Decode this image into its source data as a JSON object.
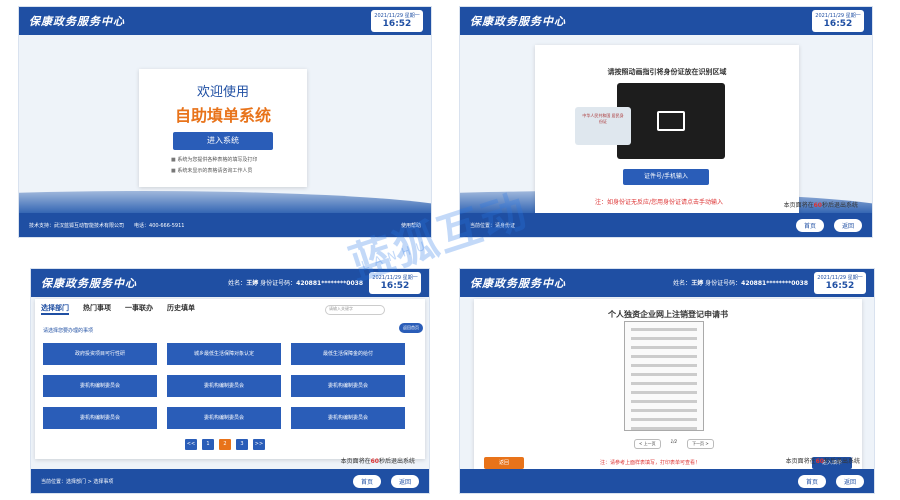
{
  "app_title": "保康政务服务中心",
  "clock": {
    "date": "2021/11/29 星期一",
    "time": "16:52"
  },
  "watermark": {
    "main": "蓝狐互动",
    "sub": "LANHU"
  },
  "panel1": {
    "welcome_line1": "欢迎使用",
    "welcome_line2": "自助填单系统",
    "enter_button": "进入系统",
    "notes": [
      "系统为您提供各种表格的填写及打印",
      "系统未显示的表格请咨询工作人员"
    ],
    "foot_left": "技术支持：武汉蓝狐互动智能技术有限公司",
    "foot_phone": "电话：400-666-5911",
    "foot_help": "使用帮助"
  },
  "panel2": {
    "instruction": "请按照动画指引将身份证放在识别区域",
    "card_text": "中华人民共和国 居民身份证",
    "input_button": "证件号/手机输入",
    "warn": "注：如身份证无反应/您用身份证请点击手动输入",
    "location": "当前位置：请身份证",
    "timer_prefix": "本页面将在",
    "timer_value": "60",
    "timer_suffix": "秒后退出系统",
    "home_button": "首页",
    "back_button": "返回"
  },
  "panel3": {
    "user_name_label": "姓名：",
    "user_name": "王婷",
    "id_label": "身份证号码：",
    "id_value": "420881********0038",
    "tabs": [
      "选择部门",
      "热门事项",
      "一事联办",
      "历史填单"
    ],
    "search_placeholder": "请输入关键字",
    "back_top": "返回首页",
    "hint": "请选择您要办理的事项",
    "items": [
      "政府投资项目可行性研",
      "城乡最低生活保障对象认定",
      "最低生活保障金的给付",
      "委机构编制委员会",
      "委机构编制委员会",
      "委机构编制委员会",
      "委机构编制委员会",
      "委机构编制委员会",
      "委机构编制委员会"
    ],
    "pages": [
      "<<",
      "1",
      "2",
      "3",
      ">>"
    ],
    "timer_prefix": "本页面将在",
    "timer_value": "60",
    "timer_suffix": "秒后退出系统",
    "location": "当前位置：选择部门 > 选择事项",
    "home_button": "首页",
    "back_button": "返回"
  },
  "panel4": {
    "user_name_label": "姓名：",
    "user_name": "王婷",
    "id_label": "身份证号码：",
    "id_value": "420881********0038",
    "title": "个人独资企业网上注销登记申请书",
    "prev": "< 上一页",
    "page": "1/2",
    "next": "下一页 >",
    "back_button_orange": "返回",
    "warn": "注：请参考上面样表填写，打印表单可查看！",
    "fill_button": "进入填单",
    "timer_prefix": "本页面将在",
    "timer_value": "60",
    "timer_suffix": "秒后退出系统",
    "home_button": "首页",
    "back_button": "返回"
  }
}
